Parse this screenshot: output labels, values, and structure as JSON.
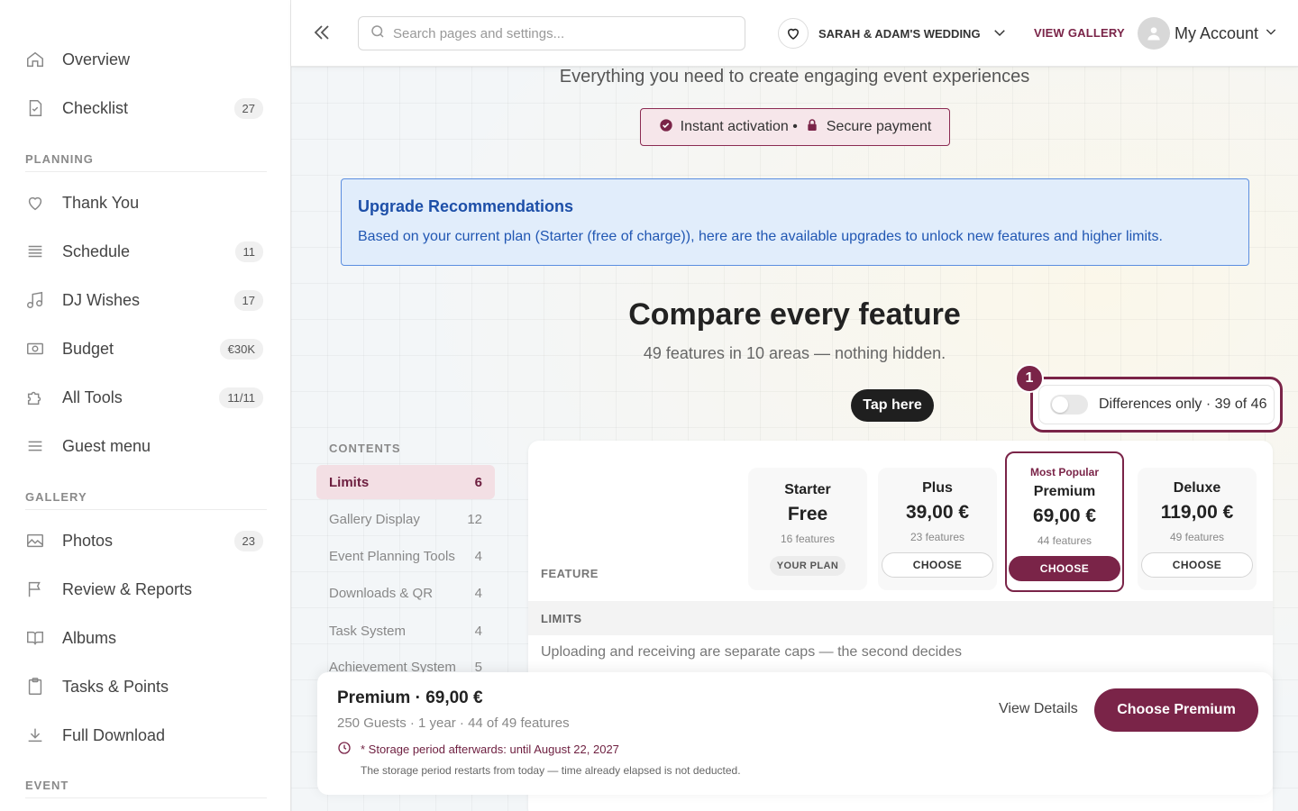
{
  "sidebar": {
    "items": [
      {
        "label": "Overview",
        "count": ""
      },
      {
        "label": "Checklist",
        "count": "27"
      },
      {
        "label": "Thank You",
        "count": ""
      },
      {
        "label": "Schedule",
        "count": "11"
      },
      {
        "label": "DJ Wishes",
        "count": "17"
      },
      {
        "label": "Budget",
        "count": "€30K"
      },
      {
        "label": "All Tools",
        "count": "11/11"
      },
      {
        "label": "Guest menu",
        "count": ""
      },
      {
        "label": "Photos",
        "count": "23"
      },
      {
        "label": "Review & Reports",
        "count": ""
      },
      {
        "label": "Albums",
        "count": ""
      },
      {
        "label": "Tasks & Points",
        "count": ""
      },
      {
        "label": "Full Download",
        "count": ""
      }
    ],
    "sections": {
      "planning": "PLANNING",
      "gallery": "GALLERY",
      "event": "EVENT"
    }
  },
  "topbar": {
    "search_placeholder": "Search pages and settings...",
    "event_name": "SARAH & ADAM'S WEDDING",
    "view_gallery": "VIEW GALLERY",
    "account": "My Account"
  },
  "hero": {
    "tagline": "Everything you need to create engaging event experiences",
    "pill_a": "Instant activation •",
    "pill_b": "Secure payment"
  },
  "upgrade": {
    "title": "Upgrade Recommendations",
    "text": "Based on your current plan (Starter (free of charge)), here are the available upgrades to unlock new features and higher limits."
  },
  "compare": {
    "title": "Compare every feature",
    "subtitle": "49 features in 10 areas — nothing hidden.",
    "tap": "Tap here",
    "badge": "1",
    "diff": "Differences only · 39 of 46"
  },
  "contents": {
    "heading": "CONTENTS",
    "items": [
      {
        "label": "Limits",
        "count": "6"
      },
      {
        "label": "Gallery Display",
        "count": "12"
      },
      {
        "label": "Event Planning Tools",
        "count": "4"
      },
      {
        "label": "Downloads & QR",
        "count": "4"
      },
      {
        "label": "Task System",
        "count": "4"
      },
      {
        "label": "Achievement System",
        "count": "5"
      }
    ]
  },
  "table": {
    "feature_header": "FEATURE",
    "plans": [
      {
        "name": "Starter",
        "price": "Free",
        "features": "16 features",
        "action": "YOUR PLAN"
      },
      {
        "name": "Plus",
        "price": "39,00 €",
        "features": "23 features",
        "action": "CHOOSE"
      },
      {
        "name": "Premium",
        "price": "69,00 €",
        "features": "44 features",
        "action": "CHOOSE",
        "tag": "Most Popular"
      },
      {
        "name": "Deluxe",
        "price": "119,00 €",
        "features": "49 features",
        "action": "CHOOSE"
      }
    ],
    "limits_row": "LIMITS",
    "note": "Uploading and receiving are separate caps — the second decides"
  },
  "bottom": {
    "title": "Premium · 69,00 €",
    "sub": "250 Guests · 1 year · 44 of 49 features",
    "storage": "* Storage period afterwards: until August 22, 2027",
    "note": "The storage period restarts from today — time already elapsed is not deducted.",
    "view_details": "View Details",
    "choose": "Choose Premium"
  },
  "colors": {
    "brand": "#7a2448",
    "info": "#1d4fa8"
  }
}
